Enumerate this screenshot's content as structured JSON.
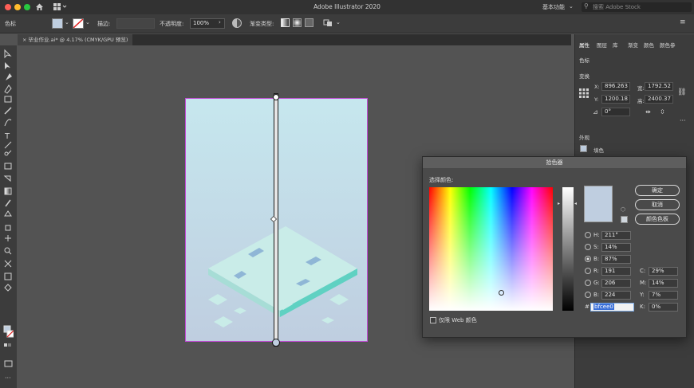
{
  "window": {
    "title": "Adobe Illustrator 2020"
  },
  "appbar": {
    "workspace": "基本功能",
    "search_placeholder": "搜索 Adobe Stock",
    "left_label": "色标",
    "stroke_label": "描边:",
    "opacity_label": "不透明度:",
    "opacity_value": "100%",
    "gradient_type_label": "渐变类型:"
  },
  "document_tab": {
    "label": "毕业作业.ai* @ 4.17% (CMYK/GPU 预览)"
  },
  "right_panel": {
    "tabs": [
      "属性",
      "图层",
      "库",
      "渐变",
      "颜色",
      "颜色参"
    ],
    "section_swatch": "色标",
    "section_transform": "变换",
    "x_label": "X:",
    "x_value": "896.263",
    "y_label": "Y:",
    "y_value": "1200.18",
    "w_label": "宽:",
    "w_value": "1792.52",
    "h_label": "高:",
    "h_value": "2400.37",
    "angle_value": "0°",
    "section_appearance": "外观",
    "fill_label": "填色"
  },
  "color_picker": {
    "title": "拾色器",
    "select_label": "选择颜色:",
    "ok_label": "确定",
    "cancel_label": "取消",
    "swatches_label": "颜色色板",
    "web_only_label": "仅限 Web 颜色",
    "h_label": "H:",
    "h_value": "211°",
    "s_label": "S:",
    "s_value": "14%",
    "b_label": "B:",
    "b_value": "87%",
    "r_label": "R:",
    "r_value": "191",
    "g_label": "G:",
    "g_value": "206",
    "bb_label": "B:",
    "bb_value": "224",
    "c_label": "C:",
    "c_value": "29%",
    "m_label": "M:",
    "m_value": "14%",
    "yy_label": "Y:",
    "yy_value": "7%",
    "k_label": "K:",
    "k_value": "0%",
    "hex_label": "#",
    "hex_value": "bfcee0",
    "selected_color": "#bfcee0"
  },
  "colors": {
    "artboard_top": "#c6e7ee",
    "artboard_bottom": "#bfcee0",
    "selection": "#c24bd6",
    "accent_teal": "#5fd1c2"
  }
}
